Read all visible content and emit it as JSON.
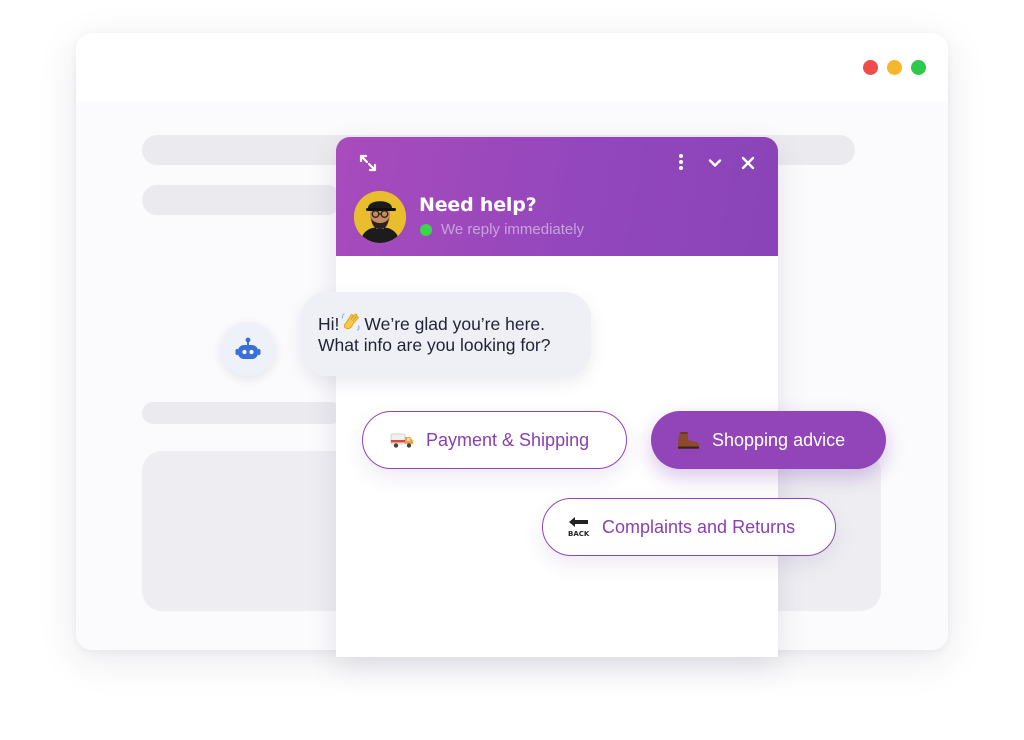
{
  "window": {
    "controls": [
      {
        "name": "close",
        "color": "#f14c4c"
      },
      {
        "name": "minimize",
        "color": "#f7b72d"
      },
      {
        "name": "maximize",
        "color": "#2ec94c"
      }
    ]
  },
  "chat": {
    "title": "Need help?",
    "status": "We reply immediately",
    "status_color": "#3ad64a",
    "accent": "#9245b8",
    "header_icons": [
      "expand-icon",
      "more-vertical-icon",
      "chevron-down-icon",
      "close-icon"
    ],
    "message": {
      "line1_before": "Hi!",
      "line1_emoji": "wave-emoji",
      "line1_after": "We’re glad you’re here.",
      "line2": "What info are you looking for?"
    },
    "options": [
      {
        "label": "Payment & Shipping",
        "icon": "delivery-truck-icon",
        "style": "outline"
      },
      {
        "label": "Shopping advice",
        "icon": "boot-icon",
        "style": "filled"
      },
      {
        "label": "Complaints and Returns",
        "icon": "back-arrow-icon",
        "style": "outline"
      }
    ]
  }
}
